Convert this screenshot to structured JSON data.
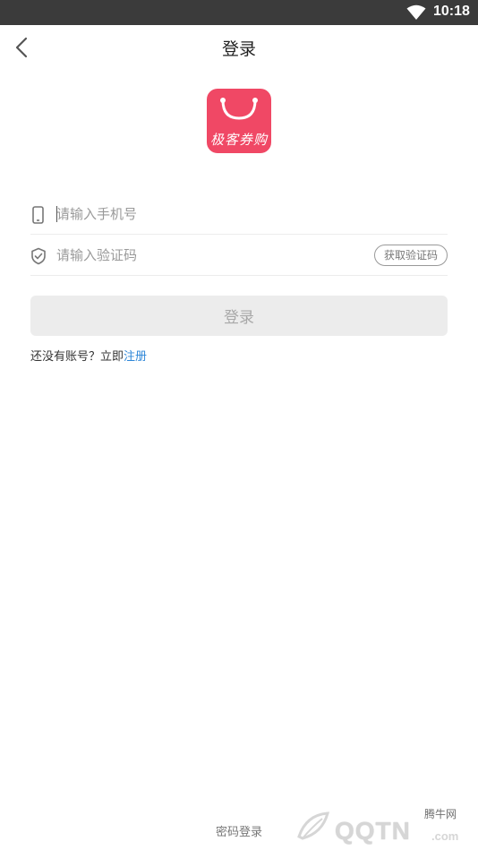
{
  "status_bar": {
    "time": "10:18",
    "wifi_icon": "wifi-icon"
  },
  "nav": {
    "title": "登录",
    "back_icon": "chevron-left-icon"
  },
  "logo": {
    "text": "极客券购",
    "bg_color": "#f04865"
  },
  "form": {
    "phone": {
      "placeholder": "请输入手机号",
      "value": "",
      "icon": "phone-icon"
    },
    "code": {
      "placeholder": "请输入验证码",
      "value": "",
      "icon": "shield-check-icon",
      "button_label": "获取验证码"
    },
    "login_label": "登录"
  },
  "register": {
    "prompt": "还没有账号？立即",
    "link": "注册",
    "link_color": "#2e87d8"
  },
  "footer": {
    "password_login": "密码登录"
  },
  "watermark": {
    "small": "腾牛网",
    "main": "QQTN",
    "suffix": ".com"
  }
}
